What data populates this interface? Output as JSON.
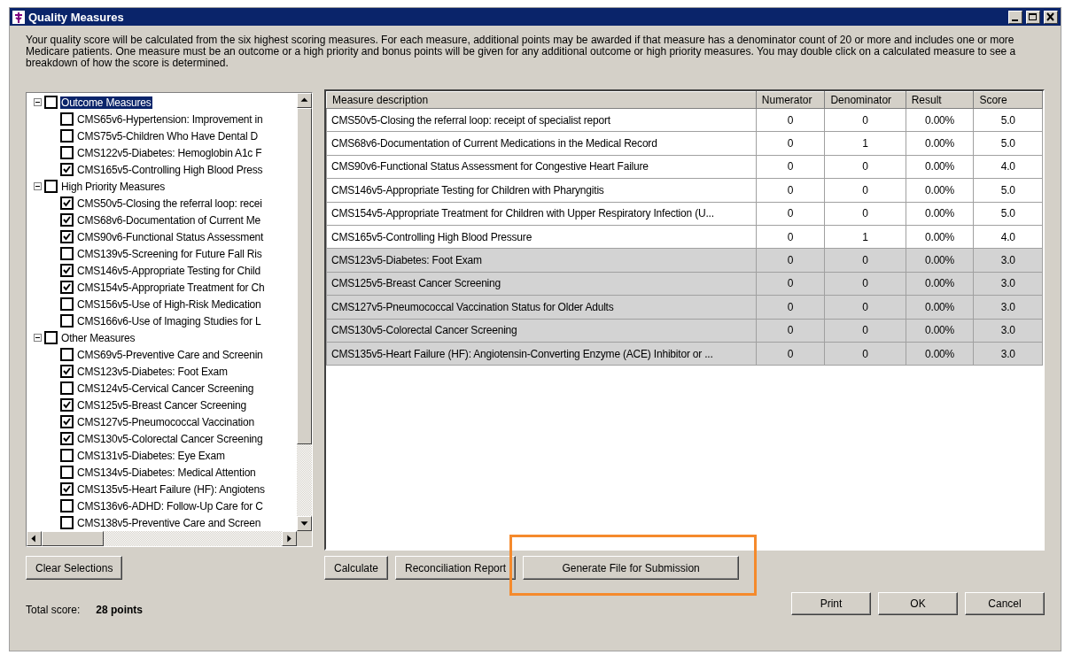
{
  "window": {
    "title": "Quality Measures"
  },
  "intro": "Your quality score will be calculated from the six highest scoring measures. For each measure, additional points may be awarded if that measure has a denominator count of 20 or more and includes one or more Medicare patients. One measure must be an outcome or a high priority and bonus points will be given for any additional outcome or high priority measures.  You may double click on a calculated measure to see a breakdown of how the score is determined.",
  "tree": [
    {
      "label": "Outcome Measures",
      "checked": false,
      "selected": true,
      "expanded": true,
      "children": [
        {
          "label": "CMS65v6-Hypertension: Improvement in",
          "checked": false
        },
        {
          "label": "CMS75v5-Children Who Have Dental D",
          "checked": false
        },
        {
          "label": "CMS122v5-Diabetes: Hemoglobin A1c F",
          "checked": false
        },
        {
          "label": "CMS165v5-Controlling High Blood Press",
          "checked": true
        }
      ]
    },
    {
      "label": "High Priority Measures",
      "checked": false,
      "selected": false,
      "expanded": true,
      "children": [
        {
          "label": "CMS50v5-Closing the referral loop: recei",
          "checked": true
        },
        {
          "label": "CMS68v6-Documentation of Current Me",
          "checked": true
        },
        {
          "label": "CMS90v6-Functional Status Assessment",
          "checked": true
        },
        {
          "label": "CMS139v5-Screening for Future Fall Ris",
          "checked": false
        },
        {
          "label": "CMS146v5-Appropriate Testing for Child",
          "checked": true
        },
        {
          "label": "CMS154v5-Appropriate Treatment for Ch",
          "checked": true
        },
        {
          "label": "CMS156v5-Use of High-Risk Medication",
          "checked": false
        },
        {
          "label": "CMS166v6-Use of Imaging Studies for L",
          "checked": false
        }
      ]
    },
    {
      "label": "Other Measures",
      "checked": false,
      "selected": false,
      "expanded": true,
      "children": [
        {
          "label": "CMS69v5-Preventive Care and Screenin",
          "checked": false
        },
        {
          "label": "CMS123v5-Diabetes: Foot Exam",
          "checked": true
        },
        {
          "label": "CMS124v5-Cervical Cancer Screening",
          "checked": false
        },
        {
          "label": "CMS125v5-Breast Cancer Screening",
          "checked": true
        },
        {
          "label": "CMS127v5-Pneumococcal Vaccination",
          "checked": true
        },
        {
          "label": "CMS130v5-Colorectal Cancer Screening",
          "checked": true
        },
        {
          "label": "CMS131v5-Diabetes: Eye Exam",
          "checked": false
        },
        {
          "label": "CMS134v5-Diabetes: Medical Attention",
          "checked": false
        },
        {
          "label": "CMS135v5-Heart Failure (HF): Angiotens",
          "checked": true
        },
        {
          "label": "CMS136v6-ADHD: Follow-Up Care for C",
          "checked": false
        },
        {
          "label": "CMS138v5-Preventive Care and Screen",
          "checked": false
        }
      ]
    }
  ],
  "table": {
    "columns": [
      "Measure description",
      "Numerator",
      "Denominator",
      "Result",
      "Score"
    ],
    "rows": [
      {
        "cells": [
          "CMS50v5-Closing the referral loop: receipt of specialist report",
          "0",
          "0",
          "0.00%",
          "5.0"
        ],
        "counted": true
      },
      {
        "cells": [
          "CMS68v6-Documentation of Current Medications in the Medical Record",
          "0",
          "1",
          "0.00%",
          "5.0"
        ],
        "counted": true
      },
      {
        "cells": [
          "CMS90v6-Functional Status Assessment for Congestive Heart Failure",
          "0",
          "0",
          "0.00%",
          "4.0"
        ],
        "counted": true
      },
      {
        "cells": [
          "CMS146v5-Appropriate Testing for Children with Pharyngitis",
          "0",
          "0",
          "0.00%",
          "5.0"
        ],
        "counted": true
      },
      {
        "cells": [
          "CMS154v5-Appropriate Treatment for Children with Upper Respiratory Infection (U...",
          "0",
          "0",
          "0.00%",
          "5.0"
        ],
        "counted": true
      },
      {
        "cells": [
          "CMS165v5-Controlling High Blood Pressure",
          "0",
          "1",
          "0.00%",
          "4.0"
        ],
        "counted": true
      },
      {
        "cells": [
          "CMS123v5-Diabetes: Foot Exam",
          "0",
          "0",
          "0.00%",
          "3.0"
        ],
        "counted": false
      },
      {
        "cells": [
          "CMS125v5-Breast Cancer Screening",
          "0",
          "0",
          "0.00%",
          "3.0"
        ],
        "counted": false
      },
      {
        "cells": [
          "CMS127v5-Pneumococcal Vaccination Status for Older Adults",
          "0",
          "0",
          "0.00%",
          "3.0"
        ],
        "counted": false
      },
      {
        "cells": [
          "CMS130v5-Colorectal Cancer Screening",
          "0",
          "0",
          "0.00%",
          "3.0"
        ],
        "counted": false
      },
      {
        "cells": [
          "CMS135v5-Heart Failure (HF): Angiotensin-Converting Enzyme (ACE) Inhibitor or  ...",
          "0",
          "0",
          "0.00%",
          "3.0"
        ],
        "counted": false
      }
    ]
  },
  "clear_button": "Clear Selections",
  "action_buttons": [
    {
      "label": "Calculate",
      "highlighted": false
    },
    {
      "label": "Reconciliation Report",
      "highlighted": false
    },
    {
      "label": "Generate File for Submission",
      "highlighted": true
    }
  ],
  "total": {
    "label": "Total score:",
    "value": "28 points"
  },
  "dialog_buttons": [
    "Print",
    "OK",
    "Cancel"
  ]
}
